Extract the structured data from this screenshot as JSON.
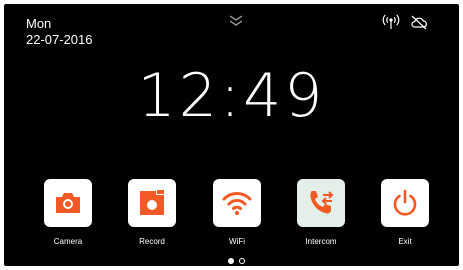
{
  "status_bar": {
    "day": "Mon",
    "date": "22-07-2016",
    "icons": [
      "pull-down-chevron",
      "wifi-signal",
      "cloud-disconnected"
    ]
  },
  "clock": {
    "time": "12:49"
  },
  "apps": [
    {
      "label": "Camera",
      "icon": "camera-icon"
    },
    {
      "label": "Record",
      "icon": "record-icon"
    },
    {
      "label": "WiFi",
      "icon": "wifi-icon"
    },
    {
      "label": "Intercom",
      "icon": "intercom-phone-icon"
    },
    {
      "label": "Exit",
      "icon": "power-icon"
    }
  ],
  "pager": {
    "pages": 2,
    "current": 1
  },
  "colors": {
    "screen_background": "#000000",
    "accent_orange": "#f15a24",
    "tile_white": "#ffffff",
    "tile_intercom": "#e5efe9",
    "text": "#ffffff"
  }
}
